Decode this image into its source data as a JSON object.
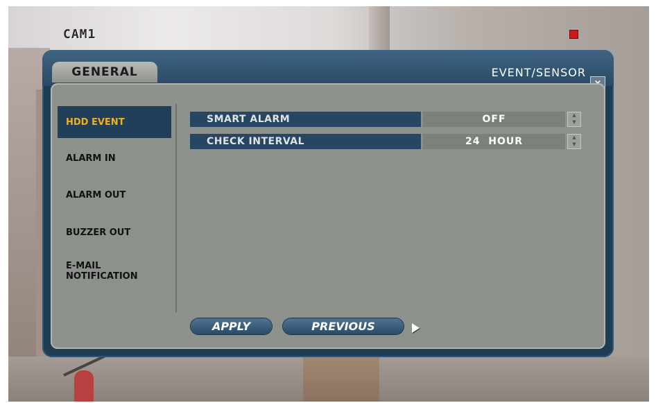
{
  "camera": {
    "label": "CAM1"
  },
  "dialog": {
    "tab": "GENERAL",
    "title": "EVENT/SENSOR",
    "close_label": "×"
  },
  "menu": {
    "items": [
      {
        "label": "HDD EVENT",
        "active": true
      },
      {
        "label": "ALARM IN"
      },
      {
        "label": "ALARM OUT"
      },
      {
        "label": "BUZZER OUT"
      },
      {
        "label": "E-MAIL NOTIFICATION"
      }
    ]
  },
  "settings": [
    {
      "label": "SMART ALARM",
      "value": "OFF"
    },
    {
      "label": "CHECK INTERVAL",
      "value": "24  HOUR"
    }
  ],
  "buttons": {
    "apply": "APPLY",
    "previous": "PREVIOUS"
  },
  "colors": {
    "accent": "#f2b01e",
    "dialog": "#1f3c55",
    "panel": "#8d918c",
    "record": "#d01818"
  }
}
